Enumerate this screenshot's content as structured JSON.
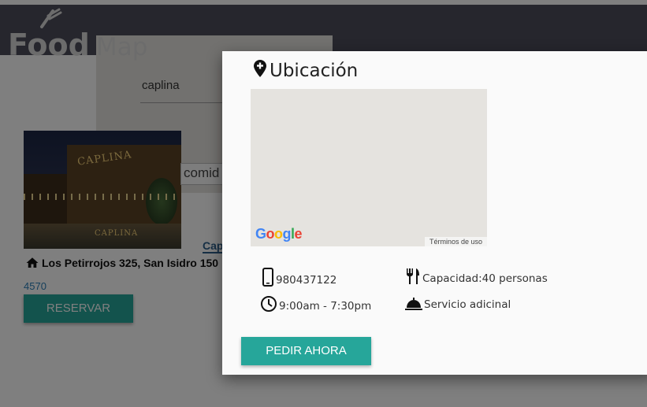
{
  "header": {
    "logo_food": "Food",
    "logo_map": "Map"
  },
  "search": {
    "value": "caplina"
  },
  "restaurant": {
    "photo_sign": "CAPLINA",
    "filter_value": "comid",
    "name_link": "Cap",
    "address": "Los Petirrojos 325, San Isidro 150",
    "address_cont": "4570",
    "reserve_label": "RESERVAR"
  },
  "modal": {
    "title": "Ubicación",
    "map_brand": "Google",
    "map_terms": "Términos de uso",
    "phone": "980437122",
    "hours": "9:00am - 7:30pm",
    "capacity": "Capacidad:40 personas",
    "service": "Servicio adicinal",
    "order_label": "PEDIR AHORA"
  },
  "colors": {
    "header_bg": "#4d4c5a",
    "accent": "#26a69a",
    "link": "#2c5f8a"
  },
  "icons": [
    "utensils-logo-icon",
    "home-icon",
    "map-pin-icon",
    "phone-icon",
    "clock-icon",
    "utensils-icon",
    "service-bell-icon"
  ]
}
